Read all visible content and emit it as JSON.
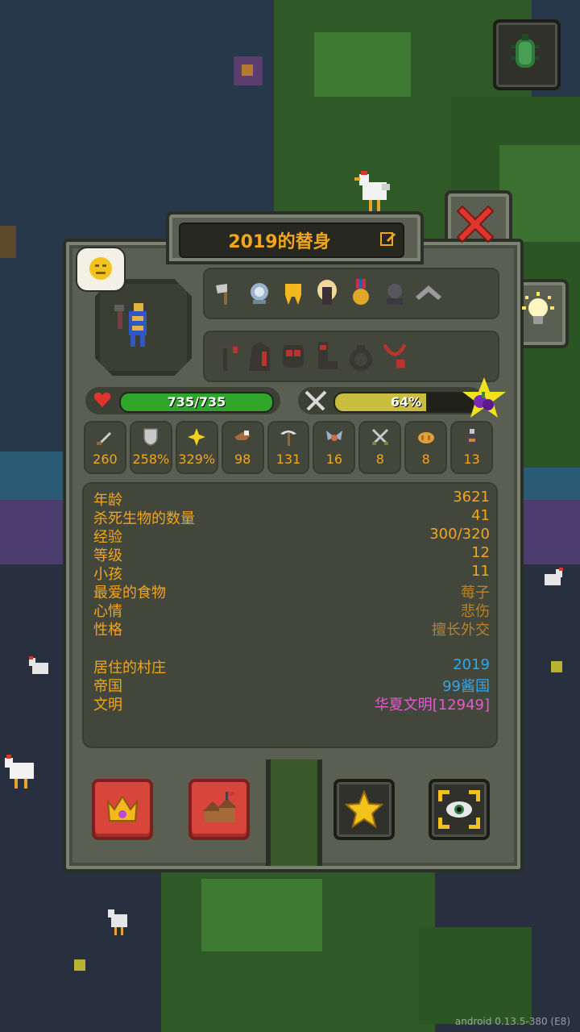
{
  "title": "2019的替身",
  "health": {
    "value": 735,
    "max": 735,
    "text": "735/735"
  },
  "food": {
    "fraction": 0.64,
    "text": "64%"
  },
  "stats": [
    {
      "icon": "sword-icon",
      "value": "260"
    },
    {
      "icon": "shield-icon",
      "value": "258%"
    },
    {
      "icon": "sparkle-icon",
      "value": "329%"
    },
    {
      "icon": "eagle-icon",
      "value": "98"
    },
    {
      "icon": "scythe-icon",
      "value": "131"
    },
    {
      "icon": "wings-icon",
      "value": "16"
    },
    {
      "icon": "crossed-swords-icon",
      "value": "8"
    },
    {
      "icon": "bread-icon",
      "value": "8"
    },
    {
      "icon": "potion-icon",
      "value": "13"
    }
  ],
  "traits": [
    "axe-trait-icon",
    "ghost-trait-icon",
    "golden-tooth-icon",
    "blonde-hair-icon",
    "medal-icon",
    "shadow-head-icon",
    "slingshot-icon"
  ],
  "equipment": [
    "pickaxe-icon",
    "hood-icon",
    "armor-icon",
    "boot-icon",
    "ring-icon",
    "amulet-icon"
  ],
  "info": [
    {
      "key": "年龄",
      "value": "3621",
      "color": "#f2a51f"
    },
    {
      "key": "杀死生物的数量",
      "value": "41",
      "color": "#f2a51f"
    },
    {
      "key": "经验",
      "value": "300/320",
      "color": "#f2a51f"
    },
    {
      "key": "等级",
      "value": "12",
      "color": "#f2a51f"
    },
    {
      "key": "小孩",
      "value": "11",
      "color": "#f2a51f"
    },
    {
      "key": "最爱的食物",
      "value": "莓子",
      "color": "#b8822a"
    },
    {
      "key": "心情",
      "value": "悲伤",
      "color": "#b8822a"
    },
    {
      "key": "性格",
      "value": "擅长外交",
      "color": "#b8822a"
    }
  ],
  "info2": [
    {
      "key": "居住的村庄",
      "value": "2019",
      "color": "#2fa8ef"
    },
    {
      "key": "帝国",
      "value": "99酱国",
      "color": "#2fa8ef"
    },
    {
      "key": "文明",
      "value": "华夏文明",
      "value2": "[12949]",
      "color": "#e35ad0",
      "color2": "#e35ad0"
    }
  ],
  "version": "android 0.13.5-380 (E8)"
}
